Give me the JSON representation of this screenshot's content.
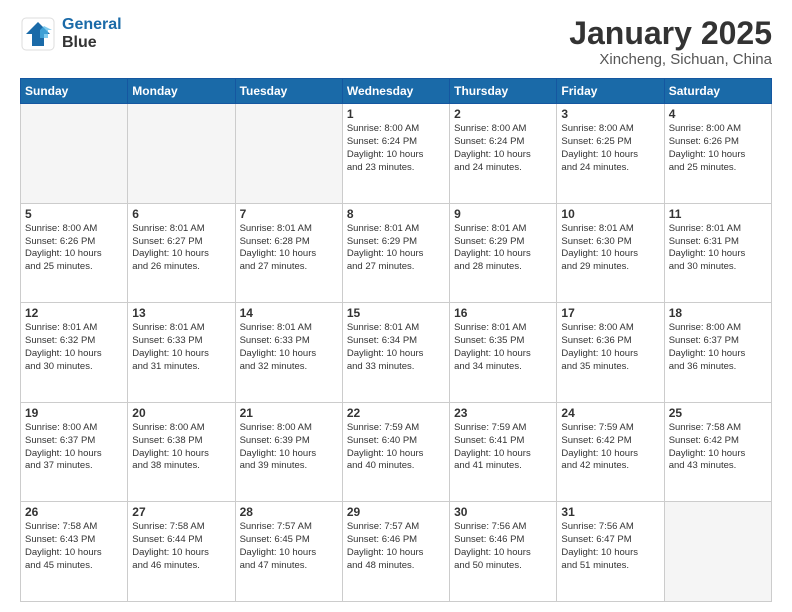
{
  "logo": {
    "line1": "General",
    "line2": "Blue"
  },
  "header": {
    "title": "January 2025",
    "subtitle": "Xincheng, Sichuan, China"
  },
  "weekdays": [
    "Sunday",
    "Monday",
    "Tuesday",
    "Wednesday",
    "Thursday",
    "Friday",
    "Saturday"
  ],
  "weeks": [
    [
      {
        "day": "",
        "empty": true
      },
      {
        "day": "",
        "empty": true
      },
      {
        "day": "",
        "empty": true
      },
      {
        "day": "1",
        "info": "Sunrise: 8:00 AM\nSunset: 6:24 PM\nDaylight: 10 hours\nand 23 minutes."
      },
      {
        "day": "2",
        "info": "Sunrise: 8:00 AM\nSunset: 6:24 PM\nDaylight: 10 hours\nand 24 minutes."
      },
      {
        "day": "3",
        "info": "Sunrise: 8:00 AM\nSunset: 6:25 PM\nDaylight: 10 hours\nand 24 minutes."
      },
      {
        "day": "4",
        "info": "Sunrise: 8:00 AM\nSunset: 6:26 PM\nDaylight: 10 hours\nand 25 minutes."
      }
    ],
    [
      {
        "day": "5",
        "info": "Sunrise: 8:00 AM\nSunset: 6:26 PM\nDaylight: 10 hours\nand 25 minutes."
      },
      {
        "day": "6",
        "info": "Sunrise: 8:01 AM\nSunset: 6:27 PM\nDaylight: 10 hours\nand 26 minutes."
      },
      {
        "day": "7",
        "info": "Sunrise: 8:01 AM\nSunset: 6:28 PM\nDaylight: 10 hours\nand 27 minutes."
      },
      {
        "day": "8",
        "info": "Sunrise: 8:01 AM\nSunset: 6:29 PM\nDaylight: 10 hours\nand 27 minutes."
      },
      {
        "day": "9",
        "info": "Sunrise: 8:01 AM\nSunset: 6:29 PM\nDaylight: 10 hours\nand 28 minutes."
      },
      {
        "day": "10",
        "info": "Sunrise: 8:01 AM\nSunset: 6:30 PM\nDaylight: 10 hours\nand 29 minutes."
      },
      {
        "day": "11",
        "info": "Sunrise: 8:01 AM\nSunset: 6:31 PM\nDaylight: 10 hours\nand 30 minutes."
      }
    ],
    [
      {
        "day": "12",
        "info": "Sunrise: 8:01 AM\nSunset: 6:32 PM\nDaylight: 10 hours\nand 30 minutes."
      },
      {
        "day": "13",
        "info": "Sunrise: 8:01 AM\nSunset: 6:33 PM\nDaylight: 10 hours\nand 31 minutes."
      },
      {
        "day": "14",
        "info": "Sunrise: 8:01 AM\nSunset: 6:33 PM\nDaylight: 10 hours\nand 32 minutes."
      },
      {
        "day": "15",
        "info": "Sunrise: 8:01 AM\nSunset: 6:34 PM\nDaylight: 10 hours\nand 33 minutes."
      },
      {
        "day": "16",
        "info": "Sunrise: 8:01 AM\nSunset: 6:35 PM\nDaylight: 10 hours\nand 34 minutes."
      },
      {
        "day": "17",
        "info": "Sunrise: 8:00 AM\nSunset: 6:36 PM\nDaylight: 10 hours\nand 35 minutes."
      },
      {
        "day": "18",
        "info": "Sunrise: 8:00 AM\nSunset: 6:37 PM\nDaylight: 10 hours\nand 36 minutes."
      }
    ],
    [
      {
        "day": "19",
        "info": "Sunrise: 8:00 AM\nSunset: 6:37 PM\nDaylight: 10 hours\nand 37 minutes."
      },
      {
        "day": "20",
        "info": "Sunrise: 8:00 AM\nSunset: 6:38 PM\nDaylight: 10 hours\nand 38 minutes."
      },
      {
        "day": "21",
        "info": "Sunrise: 8:00 AM\nSunset: 6:39 PM\nDaylight: 10 hours\nand 39 minutes."
      },
      {
        "day": "22",
        "info": "Sunrise: 7:59 AM\nSunset: 6:40 PM\nDaylight: 10 hours\nand 40 minutes."
      },
      {
        "day": "23",
        "info": "Sunrise: 7:59 AM\nSunset: 6:41 PM\nDaylight: 10 hours\nand 41 minutes."
      },
      {
        "day": "24",
        "info": "Sunrise: 7:59 AM\nSunset: 6:42 PM\nDaylight: 10 hours\nand 42 minutes."
      },
      {
        "day": "25",
        "info": "Sunrise: 7:58 AM\nSunset: 6:42 PM\nDaylight: 10 hours\nand 43 minutes."
      }
    ],
    [
      {
        "day": "26",
        "info": "Sunrise: 7:58 AM\nSunset: 6:43 PM\nDaylight: 10 hours\nand 45 minutes."
      },
      {
        "day": "27",
        "info": "Sunrise: 7:58 AM\nSunset: 6:44 PM\nDaylight: 10 hours\nand 46 minutes."
      },
      {
        "day": "28",
        "info": "Sunrise: 7:57 AM\nSunset: 6:45 PM\nDaylight: 10 hours\nand 47 minutes."
      },
      {
        "day": "29",
        "info": "Sunrise: 7:57 AM\nSunset: 6:46 PM\nDaylight: 10 hours\nand 48 minutes."
      },
      {
        "day": "30",
        "info": "Sunrise: 7:56 AM\nSunset: 6:46 PM\nDaylight: 10 hours\nand 50 minutes."
      },
      {
        "day": "31",
        "info": "Sunrise: 7:56 AM\nSunset: 6:47 PM\nDaylight: 10 hours\nand 51 minutes."
      },
      {
        "day": "",
        "empty": true
      }
    ]
  ]
}
